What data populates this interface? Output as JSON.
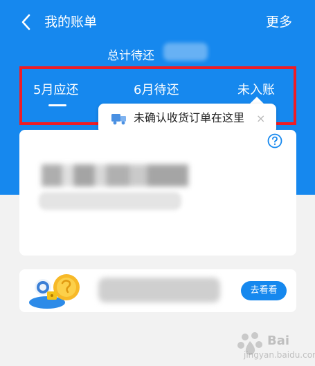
{
  "nav": {
    "title": "我的账单",
    "more_label": "更多"
  },
  "summary": {
    "total_label": "总计待还"
  },
  "tabs": [
    {
      "label": "5月应还",
      "active": true
    },
    {
      "label": "6月待还",
      "active": false
    },
    {
      "label": "未入账",
      "active": false
    }
  ],
  "tooltip": {
    "text": "未确认收货订单在这里",
    "close": "×"
  },
  "promo": {
    "button_label": "去看看"
  },
  "watermark": {
    "main": "Bai",
    "sub": "jingyan.baidu.com"
  },
  "colors": {
    "brand_blue": "#1688ee",
    "highlight_red": "#ee1c25",
    "background": "#f2f2f2"
  }
}
